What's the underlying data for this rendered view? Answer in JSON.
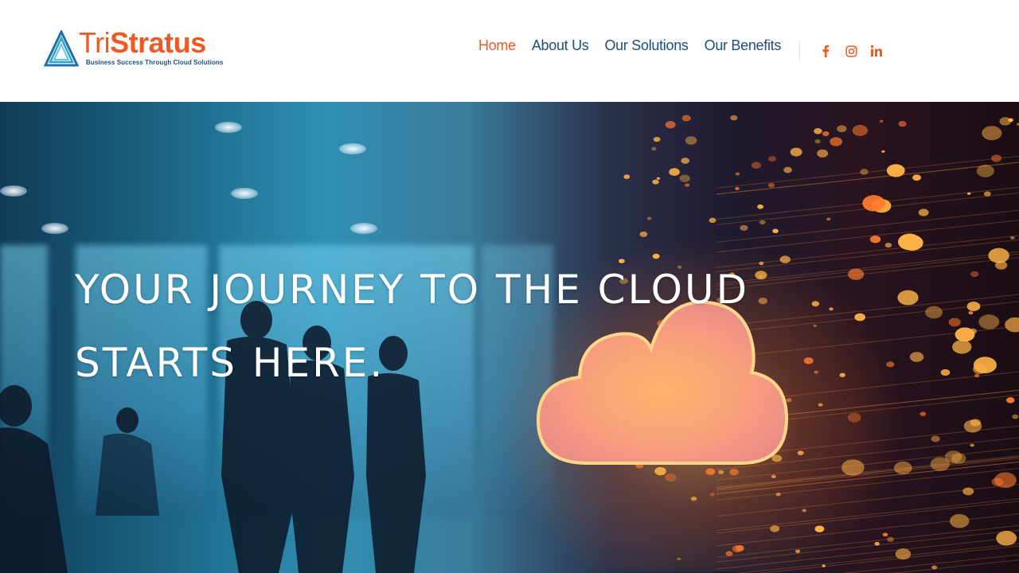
{
  "brand": {
    "name_light": "Tri",
    "name_bold": "Stratus",
    "tagline": "Business Success Through Cloud Solutions",
    "color_primary": "#ef5a24",
    "color_secondary": "#1d4e7a"
  },
  "nav": {
    "items": [
      {
        "label": "Home",
        "active": true
      },
      {
        "label": "About Us",
        "active": false
      },
      {
        "label": "Our Solutions",
        "active": false
      },
      {
        "label": "Our Benefits",
        "active": false
      }
    ]
  },
  "social": {
    "icons": [
      "facebook-icon",
      "instagram-icon",
      "linkedin-icon"
    ],
    "color": "#ef5a24"
  },
  "hero": {
    "title_line1": "YOUR JOURNEY TO THE CLOUD",
    "title_line2": "STARTS HERE."
  }
}
